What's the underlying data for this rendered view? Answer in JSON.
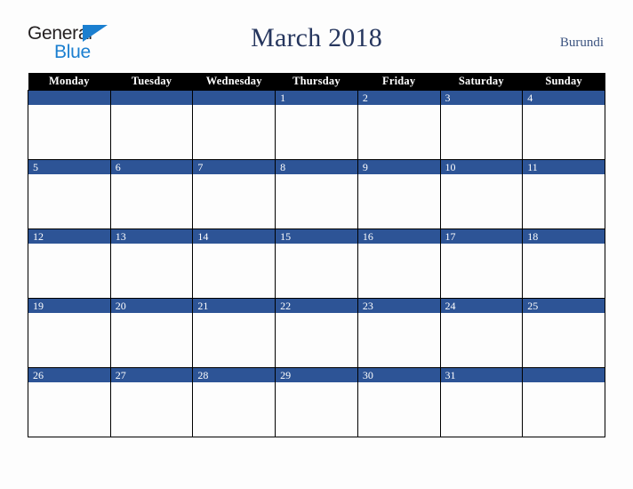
{
  "brand": {
    "line1": "General",
    "line2": "Blue",
    "triangle_color": "#1b7fd0",
    "text_color": "#231f20"
  },
  "header": {
    "title": "March 2018",
    "country": "Burundi",
    "title_color": "#26365e",
    "country_color": "#3c5480"
  },
  "calendar": {
    "accent_color": "#2d5496",
    "header_bg": "#000000",
    "header_fg": "#ffffff",
    "weekday_headers": [
      "Monday",
      "Tuesday",
      "Wednesday",
      "Thursday",
      "Friday",
      "Saturday",
      "Sunday"
    ],
    "weeks": [
      {
        "days": [
          {
            "num": ""
          },
          {
            "num": ""
          },
          {
            "num": ""
          },
          {
            "num": "1"
          },
          {
            "num": "2"
          },
          {
            "num": "3"
          },
          {
            "num": "4"
          }
        ]
      },
      {
        "days": [
          {
            "num": "5"
          },
          {
            "num": "6"
          },
          {
            "num": "7"
          },
          {
            "num": "8"
          },
          {
            "num": "9"
          },
          {
            "num": "10"
          },
          {
            "num": "11"
          }
        ]
      },
      {
        "days": [
          {
            "num": "12"
          },
          {
            "num": "13"
          },
          {
            "num": "14"
          },
          {
            "num": "15"
          },
          {
            "num": "16"
          },
          {
            "num": "17"
          },
          {
            "num": "18"
          }
        ]
      },
      {
        "days": [
          {
            "num": "19"
          },
          {
            "num": "20"
          },
          {
            "num": "21"
          },
          {
            "num": "22"
          },
          {
            "num": "23"
          },
          {
            "num": "24"
          },
          {
            "num": "25"
          }
        ]
      },
      {
        "days": [
          {
            "num": "26"
          },
          {
            "num": "27"
          },
          {
            "num": "28"
          },
          {
            "num": "29"
          },
          {
            "num": "30"
          },
          {
            "num": "31"
          },
          {
            "num": ""
          }
        ]
      }
    ]
  }
}
